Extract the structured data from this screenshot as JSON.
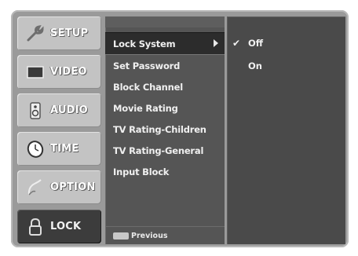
{
  "categories": [
    {
      "label": "SETUP",
      "icon": "wrench-icon"
    },
    {
      "label": "VIDEO",
      "icon": "tv-screen-icon"
    },
    {
      "label": "AUDIO",
      "icon": "speaker-icon"
    },
    {
      "label": "TIME",
      "icon": "clock-icon"
    },
    {
      "label": "OPTION",
      "icon": "option-icon"
    },
    {
      "label": "LOCK",
      "icon": "padlock-icon"
    }
  ],
  "active_category": "LOCK",
  "submenu": {
    "items": [
      {
        "label": "Lock System"
      },
      {
        "label": "Set Password"
      },
      {
        "label": "Block Channel"
      },
      {
        "label": "Movie Rating"
      },
      {
        "label": "TV Rating-Children"
      },
      {
        "label": "TV Rating-General"
      },
      {
        "label": "Input Block"
      }
    ],
    "selected": "Lock System",
    "previous_label": "Previous"
  },
  "options": {
    "items": [
      {
        "check": "✔",
        "label": "Off"
      },
      {
        "check": "",
        "label": "On"
      }
    ],
    "selected": "Off"
  },
  "colors": {
    "frame": "#9a9a9a",
    "category_bg": "#c3c3c3",
    "active_category_bg": "#3c3c3c",
    "submenu_bg": "#555555",
    "options_bg": "#4a4a4a",
    "text": "#f0f0f0"
  }
}
